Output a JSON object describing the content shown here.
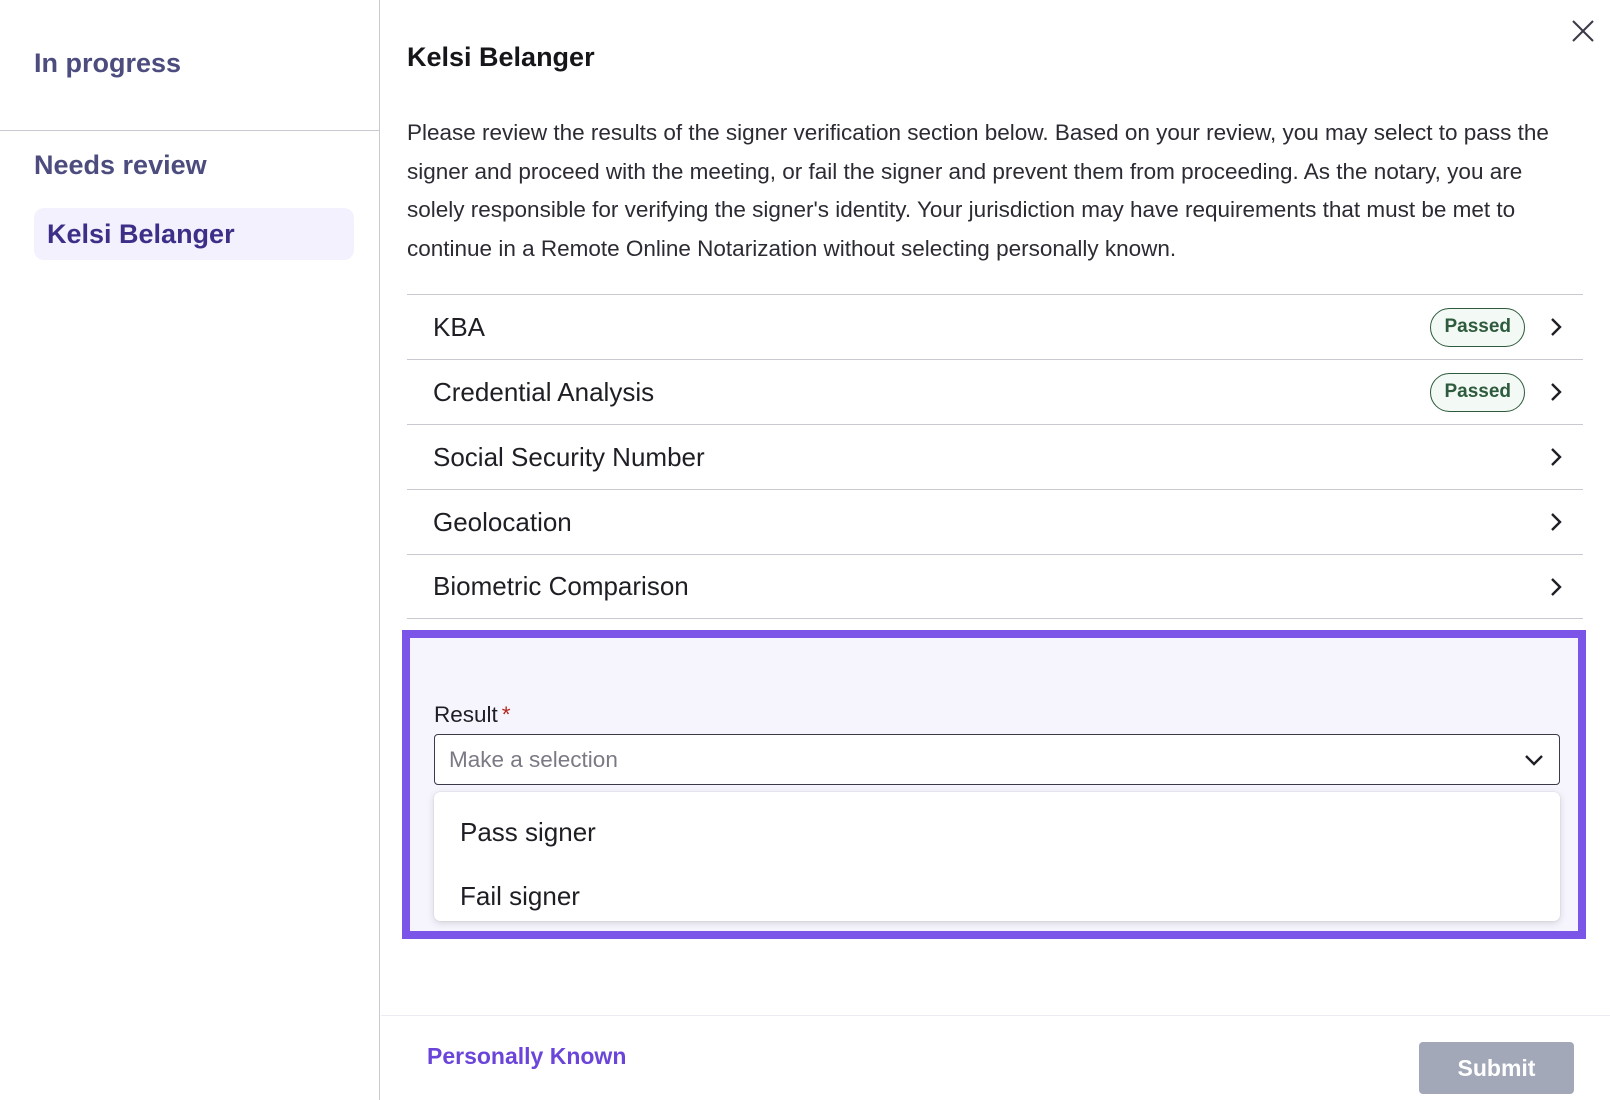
{
  "sidebar": {
    "in_progress_title": "In progress",
    "needs_review_title": "Needs review",
    "items": [
      {
        "label": "Kelsi Belanger",
        "selected": true
      }
    ]
  },
  "main": {
    "title": "Kelsi Belanger",
    "description": "Please review the results of the signer verification section below. Based on your review, you may select to pass the signer and proceed with the meeting, or fail the signer and prevent them from proceeding. As the notary, you are solely responsible for verifying the signer's identity. Your jurisdiction may have requirements that must be met to continue in a Remote Online Notarization without selecting personally known.",
    "sections": [
      {
        "label": "KBA",
        "badge": "Passed"
      },
      {
        "label": "Credential Analysis",
        "badge": "Passed"
      },
      {
        "label": "Social Security Number",
        "badge": ""
      },
      {
        "label": "Geolocation",
        "badge": ""
      },
      {
        "label": "Biometric Comparison",
        "badge": ""
      }
    ],
    "result": {
      "label": "Result",
      "required_marker": "*",
      "placeholder": "Make a selection",
      "options": [
        "Pass signer",
        "Fail signer"
      ]
    }
  },
  "footer": {
    "personally_known_label": "Personally Known",
    "submit_label": "Submit"
  },
  "colors": {
    "accent": "#7b54e8",
    "sidebar_text": "#4c4c7e",
    "badge_green": "#2e5b3d",
    "submit_disabled": "#a2a8b8"
  },
  "icons": {
    "close": "close-icon",
    "row_chevron": "chevron-right-icon",
    "select_chevron": "chevron-down-icon"
  }
}
